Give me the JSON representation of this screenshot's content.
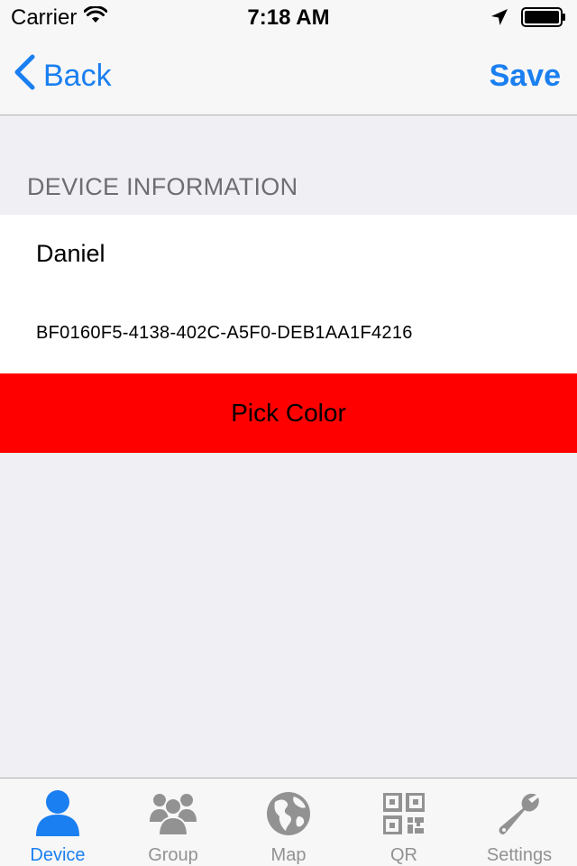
{
  "status_bar": {
    "carrier": "Carrier",
    "time": "7:18 AM"
  },
  "nav": {
    "back_label": "Back",
    "save_label": "Save"
  },
  "section": {
    "header": "DEVICE INFORMATION",
    "device_name": "Daniel",
    "device_uuid": "BF0160F5-4138-402C-A5F0-DEB1AA1F4216"
  },
  "pick_color": {
    "label": "Pick Color",
    "color": "#ff0000"
  },
  "tabs": [
    {
      "label": "Device",
      "icon": "person-icon",
      "active": true
    },
    {
      "label": "Group",
      "icon": "group-icon",
      "active": false
    },
    {
      "label": "Map",
      "icon": "globe-icon",
      "active": false
    },
    {
      "label": "QR",
      "icon": "qr-code-icon",
      "active": false
    },
    {
      "label": "Settings",
      "icon": "wrench-icon",
      "active": false
    }
  ],
  "colors": {
    "accent": "#1a7ff0",
    "inactive": "#929292",
    "background": "#efeff4"
  }
}
